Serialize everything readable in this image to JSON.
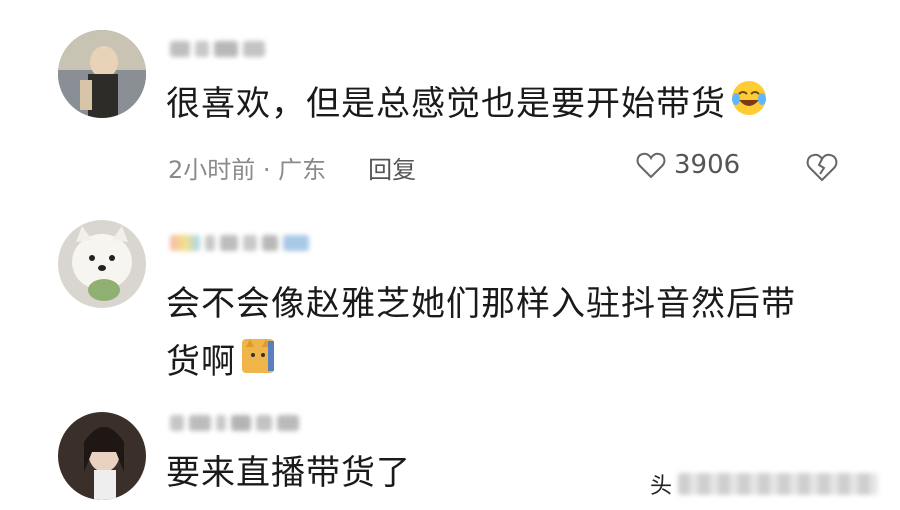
{
  "comments": [
    {
      "text": "很喜欢，但是总感觉也是要开始带货",
      "meta": {
        "time": "2小时前 · 广东",
        "reply_label": "回复",
        "likes": "3906"
      }
    },
    {
      "text_line1": "会不会像赵雅芝她们那样入驻抖音然后带",
      "text_line2": "货啊"
    },
    {
      "text": "要来直播带货了"
    }
  ],
  "watermark": {
    "prefix": "头"
  },
  "icons": {
    "like": "heart-outline-icon",
    "dislike": "broken-heart-icon",
    "emoji_1": "laughing-tears-emoji",
    "emoji_2": "cat-emoji"
  },
  "colors": {
    "meta_text": "#8a8a8a",
    "body_text": "#1a1a1a"
  }
}
